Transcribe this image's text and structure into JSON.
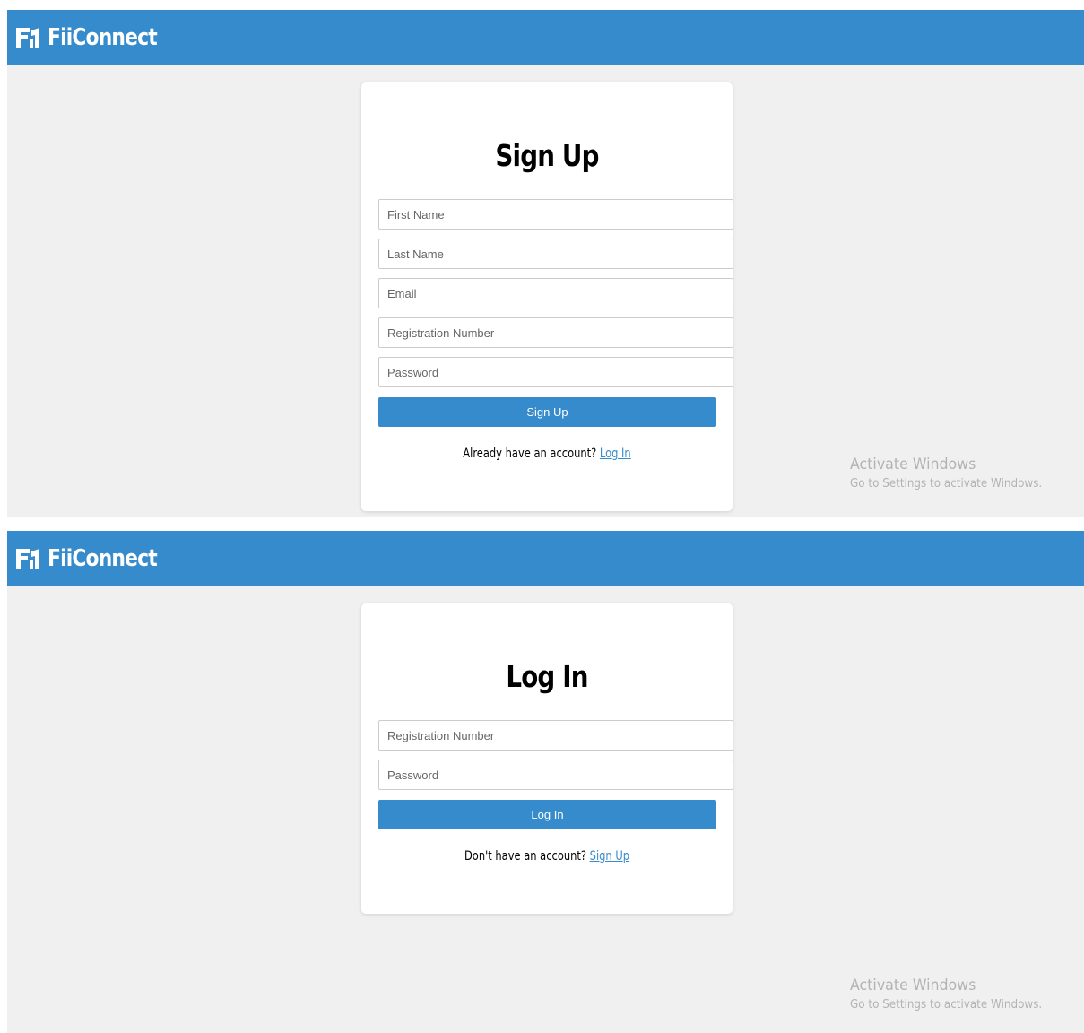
{
  "brand": {
    "name": "FiiConnect",
    "logo_icon": "fii-logo-icon",
    "color": "#368bcc"
  },
  "signup": {
    "title": "Sign Up",
    "fields": {
      "first_name": "First Name",
      "last_name": "Last Name",
      "email": "Email",
      "registration_number": "Registration Number",
      "password": "Password"
    },
    "submit_label": "Sign Up",
    "alt_text": "Already have an account?",
    "alt_link": "Log In"
  },
  "login": {
    "title": "Log In",
    "fields": {
      "registration_number": "Registration Number",
      "password": "Password"
    },
    "submit_label": "Log In",
    "alt_text": "Don't have an account?",
    "alt_link": "Sign Up"
  },
  "watermark": {
    "title": "Activate Windows",
    "subtitle": "Go to Settings to activate Windows."
  }
}
